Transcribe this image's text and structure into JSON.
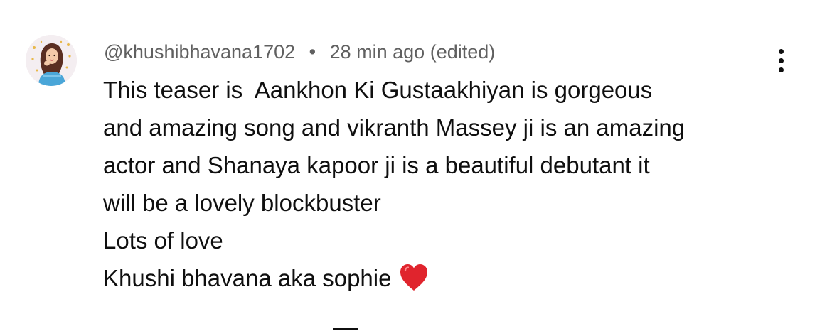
{
  "comment": {
    "author": "@khushibhavana1702",
    "separator": "•",
    "timestamp": "28 min ago (edited)",
    "avatar_icon": "girl-avatar-icon",
    "menu_icon": "more-vertical-icon",
    "lines": [
      "This teaser is  Aankhon Ki Gustaakhiyan is gorgeous",
      "and amazing song and vikranth Massey ji is an amazing",
      "actor and Shanaya kapoor ji is a beautiful debutant it",
      "will be a lovely blockbuster",
      "Lots of love",
      "Khushi bhavana aka sophie"
    ],
    "emoji_icon": "red-heart-icon",
    "colors": {
      "text": "#0f0f0f",
      "meta": "#606060",
      "heart": "#e0242d"
    }
  }
}
